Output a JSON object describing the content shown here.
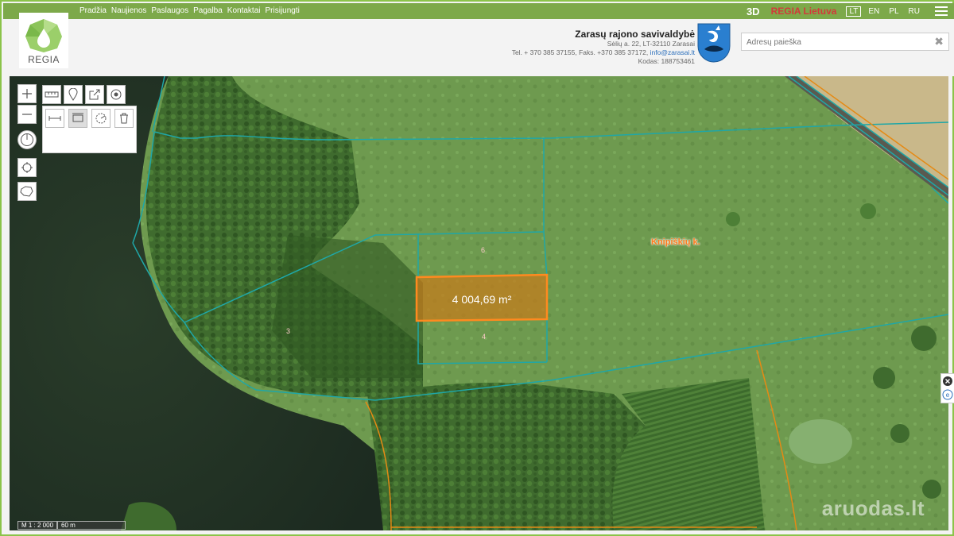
{
  "topnav": {
    "items": [
      "Pradžia",
      "Naujienos",
      "Paslaugos",
      "Pagalba",
      "Kontaktai",
      "Prisijungti"
    ]
  },
  "rightnav": {
    "mode_3d": "3D",
    "regia": "REGIA Lietuva",
    "langs": [
      "LT",
      "EN",
      "PL",
      "RU"
    ],
    "active_lang": "LT"
  },
  "logo": {
    "text": "REGIA"
  },
  "municipality": {
    "name": "Zarasų rajono savivaldybė",
    "address": "Sėlių a. 22, LT-32110 Zarasai",
    "phone_fax": "Tel. + 370 385 37155, Faks. +370 385 37172,",
    "email": "info@zarasai.lt",
    "code": "Kodas: 188753461"
  },
  "search": {
    "placeholder": "Adresų paieška",
    "value": ""
  },
  "map": {
    "measured_area": "4 004,69 m²",
    "village_label": "Knipiškių k.",
    "lot_numbers": [
      "6",
      "4",
      "3"
    ],
    "scale_ratio": "M 1 : 2 000",
    "scale_length": "60 m",
    "watermark": "aruodas.lt"
  },
  "colors": {
    "accent": "#7da94a",
    "parcel_line": "#1fa7a7",
    "area_fill": "#c97a1a",
    "road_line": "#e58a14"
  }
}
